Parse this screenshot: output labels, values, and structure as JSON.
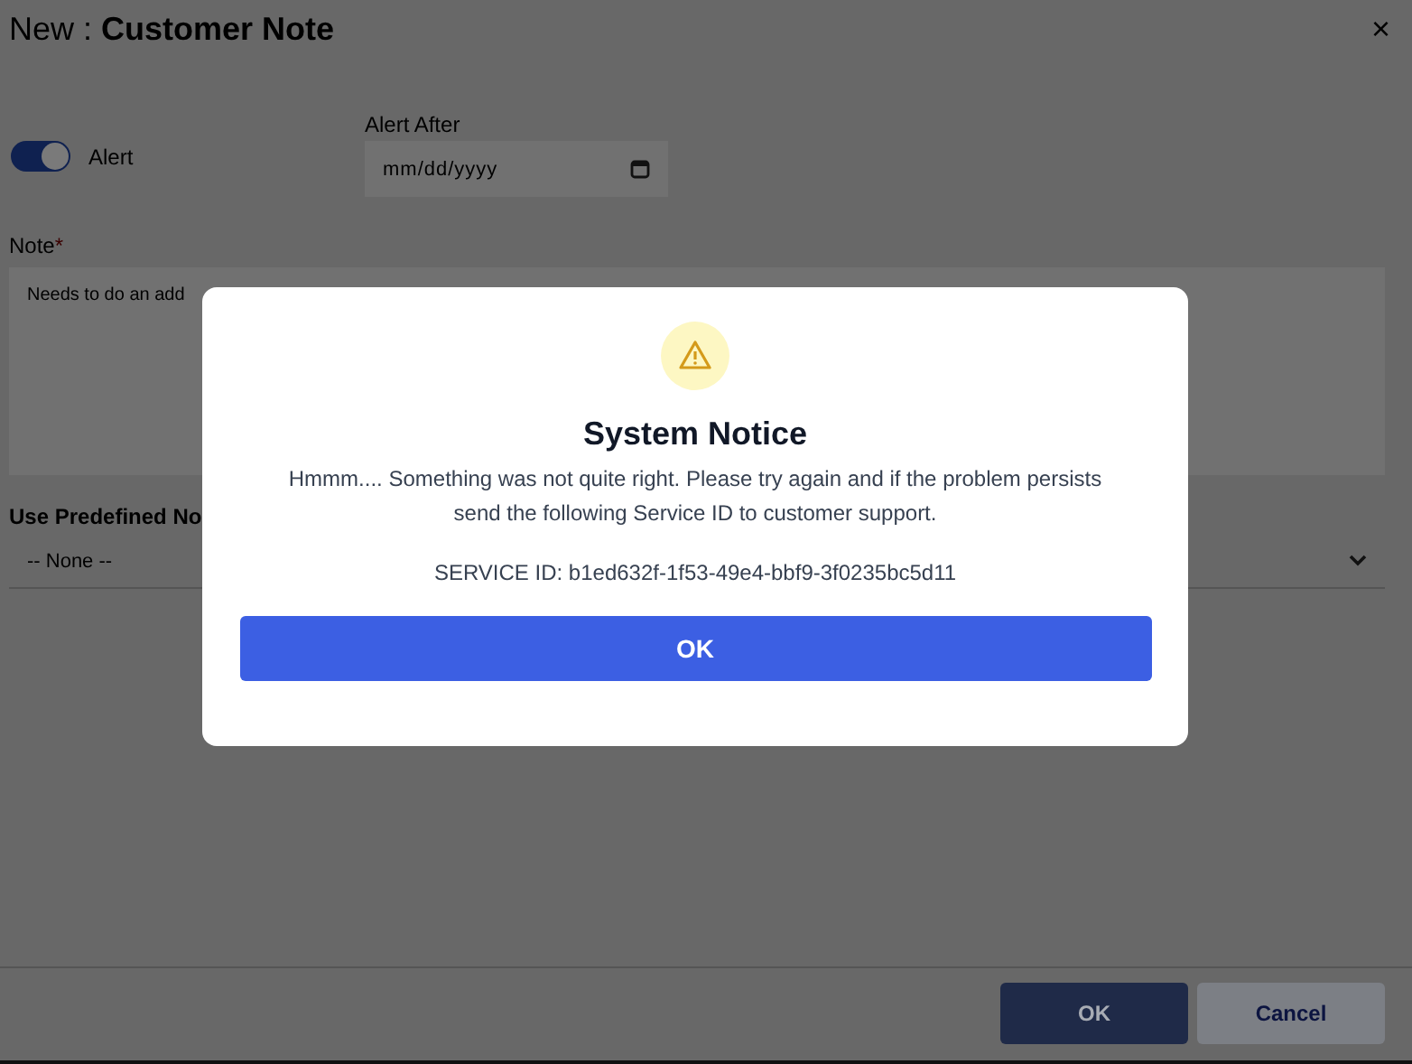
{
  "window": {
    "title_prefix": "New : ",
    "title": "Customer Note",
    "close": "×"
  },
  "alert_toggle": {
    "label": "Alert",
    "on": true
  },
  "alert_after": {
    "label": "Alert After",
    "placeholder": "mm/dd/yyyy"
  },
  "note": {
    "label": "Note",
    "required_mark": "*",
    "value": "Needs to do an add"
  },
  "predefined": {
    "label": "Use Predefined No",
    "value": "-- None --"
  },
  "footer_buttons": [
    {
      "label": "OK",
      "kind": "primary"
    },
    {
      "label": "Cancel",
      "kind": "secondary"
    }
  ],
  "dialog": {
    "title": "System Notice",
    "message": "Hmmm.... Something was not quite right. Please try again and if the problem persists send the following Service ID to customer support.",
    "service_id": "SERVICE ID: b1ed632f-1f53-49e4-bbf9-3f0235bc5d11",
    "button": "OK"
  }
}
